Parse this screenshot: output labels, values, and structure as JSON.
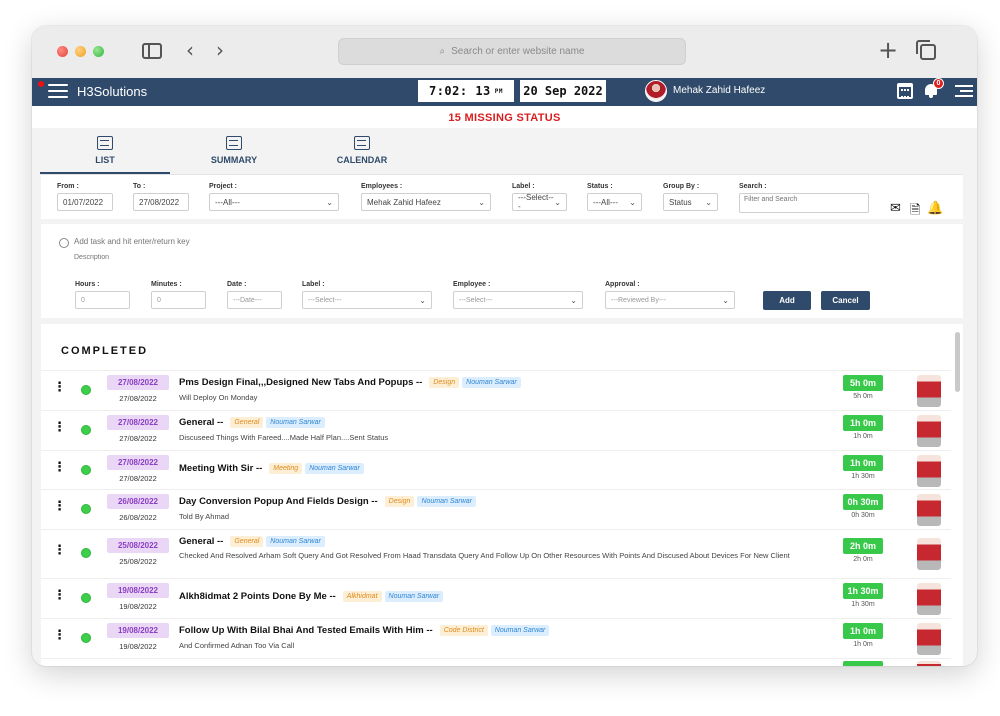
{
  "browser": {
    "address_placeholder": "Search or enter website name"
  },
  "app": {
    "brand": "H3Solutions",
    "time": "7:02: 13",
    "ampm": "PM",
    "date": "20 Sep 2022",
    "user": "Mehak Zahid Hafeez",
    "notification_count": "0",
    "missing_status": "15 MISSING STATUS"
  },
  "view_tabs": [
    {
      "label": "LIST",
      "active": true
    },
    {
      "label": "SUMMARY",
      "active": false
    },
    {
      "label": "CALENDAR",
      "active": false
    }
  ],
  "filters": {
    "from_label": "From :",
    "from_value": "01/07/2022",
    "to_label": "To :",
    "to_value": "27/08/2022",
    "project_label": "Project :",
    "project_value": "---All---",
    "employees_label": "Employees :",
    "employees_value": "Mehak Zahid Hafeez",
    "label_label": "Label :",
    "label_value": "---Select---",
    "status_label": "Status :",
    "status_value": "---All---",
    "groupby_label": "Group By :",
    "groupby_value": "Status",
    "search_label": "Search :",
    "search_placeholder": "Filter and Search"
  },
  "add_task": {
    "task_placeholder": "Add task and hit enter/return key",
    "description_placeholder": "Description",
    "hours_label": "Hours :",
    "hours_placeholder": "0",
    "minutes_label": "Minutes :",
    "minutes_placeholder": "0",
    "date_label": "Date :",
    "date_placeholder": "---Date---",
    "label_label": "Label :",
    "label_value": "---Select---",
    "employee_label": "Employee :",
    "employee_value": "---Select---",
    "approval_label": "Approval :",
    "approval_value": "---Reviewed By---",
    "add_button": "Add",
    "cancel_button": "Cancel"
  },
  "list": {
    "section_title": "COMPLETED",
    "rows": [
      {
        "date": "27/08/2022",
        "date_sub": "27/08/2022",
        "title": "Pms Design Final,,,Designed New Tabs And Popups --",
        "label": "Design",
        "employee": "Nouman Sarwar",
        "desc": "Will Deploy On Monday",
        "hours": "5h 0m",
        "hours_sub": "5h 0m"
      },
      {
        "date": "27/08/2022",
        "date_sub": "27/08/2022",
        "title": "General --",
        "label": "General",
        "employee": "Nouman Sarwar",
        "desc": "Discuseed Things With Fareed....Made Half Plan....Sent Status",
        "hours": "1h 0m",
        "hours_sub": "1h 0m"
      },
      {
        "date": "27/08/2022",
        "date_sub": "27/08/2022",
        "title": "Meeting With Sir --",
        "label": "Meeting",
        "employee": "Nouman Sarwar",
        "desc": "",
        "hours": "1h 0m",
        "hours_sub": "1h 30m"
      },
      {
        "date": "26/08/2022",
        "date_sub": "26/08/2022",
        "title": "Day Conversion Popup And Fields Design --",
        "label": "Design",
        "employee": "Nouman Sarwar",
        "desc": "Told By Ahmad",
        "hours": "0h 30m",
        "hours_sub": "0h 30m"
      },
      {
        "date": "25/08/2022",
        "date_sub": "25/08/2022",
        "title": "General --",
        "label": "General",
        "employee": "Nouman Sarwar",
        "desc": "Checked And Resolved Arham Soft Query And Got Resolved From Haad Transdata Query And Follow Up On Other Resources With Points And Discused About Devices For New Client",
        "hours": "2h 0m",
        "hours_sub": "2h 0m"
      },
      {
        "date": "19/08/2022",
        "date_sub": "19/08/2022",
        "title": "Alkh8idmat 2 Points Done By Me --",
        "label": "Alkhidmat",
        "employee": "Nouman Sarwar",
        "desc": "",
        "hours": "1h 30m",
        "hours_sub": "1h 30m"
      },
      {
        "date": "19/08/2022",
        "date_sub": "19/08/2022",
        "title": "Follow Up With Bilal Bhai And Tested Emails With Him  --",
        "label": "Code District",
        "employee": "Nouman Sarwar",
        "desc": "And Confirmed Adnan Too Via Call",
        "hours": "1h 0m",
        "hours_sub": "1h 0m"
      }
    ]
  },
  "colors": {
    "header": "#2f4a6a",
    "missing": "#d81f1f",
    "hours_badge": "#39c94a",
    "date_tag_bg": "#ead6f5",
    "date_tag_text": "#8a3fc5"
  }
}
